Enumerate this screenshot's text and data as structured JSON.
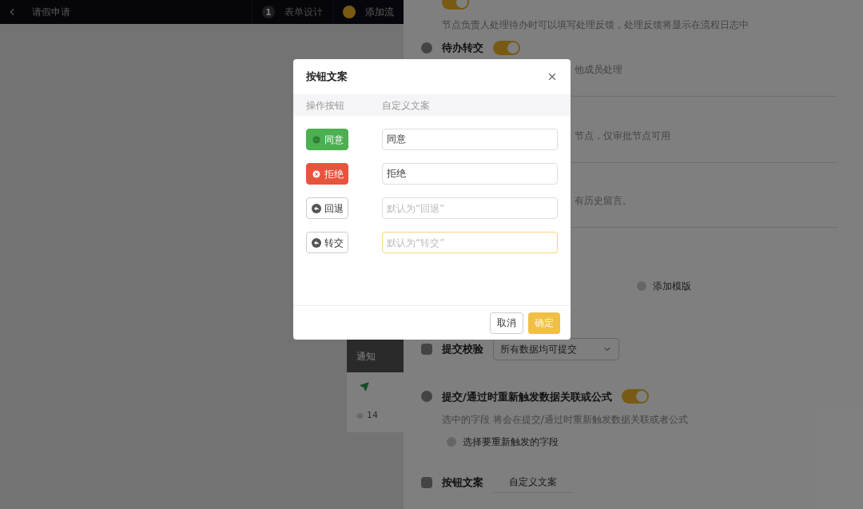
{
  "header": {
    "title": "请假申请",
    "steps": [
      {
        "number": "1",
        "label": "表单设计",
        "selected": false
      },
      {
        "label": "添加流",
        "selected": true
      }
    ]
  },
  "canvas": {
    "node": {
      "title": "通知",
      "count": "14"
    }
  },
  "panel": {
    "items": [
      {
        "kind": "toggle",
        "description": "节点负责人处理待办时可以填写处理反馈，处理反馈将显示在流程日志中",
        "on": true
      },
      {
        "kind": "toggle",
        "title": "待办转交",
        "on": true
      },
      {
        "kind": "note",
        "description": "他成员处理"
      },
      {
        "kind": "note",
        "description": "节点，仅审批节点可用"
      },
      {
        "kind": "note",
        "description": "有历史留言。"
      },
      {
        "kind": "radio",
        "label": "添加模版"
      },
      {
        "kind": "select",
        "title": "提交校验",
        "value": "所有数据均可提交"
      },
      {
        "kind": "toggle",
        "title": "提交/通过时重新触发数据关联或公式",
        "description": "选中的字段 将会在提交/通过时重新触发数据关联或者公式",
        "option": "选择要重新触发的字段",
        "on": true
      },
      {
        "kind": "field",
        "title": "按钮文案",
        "value": "自定义文案"
      }
    ]
  },
  "dialog": {
    "title": "按钮文案",
    "columns": [
      "操作按钮",
      "自定义文案"
    ],
    "rows": [
      {
        "label": "同意",
        "kind": "success",
        "value": "同意",
        "focused": false
      },
      {
        "label": "拒绝",
        "kind": "danger",
        "value": "拒绝",
        "focused": false
      },
      {
        "label": "回退",
        "kind": "default",
        "placeholder": "默认为“回退”",
        "focused": false
      },
      {
        "label": "转交",
        "kind": "default",
        "placeholder": "默认为“转交”",
        "focused": true
      }
    ],
    "buttons": [
      {
        "label": "取消",
        "kind": "secondary"
      },
      {
        "label": "确定",
        "kind": "primary"
      }
    ]
  }
}
